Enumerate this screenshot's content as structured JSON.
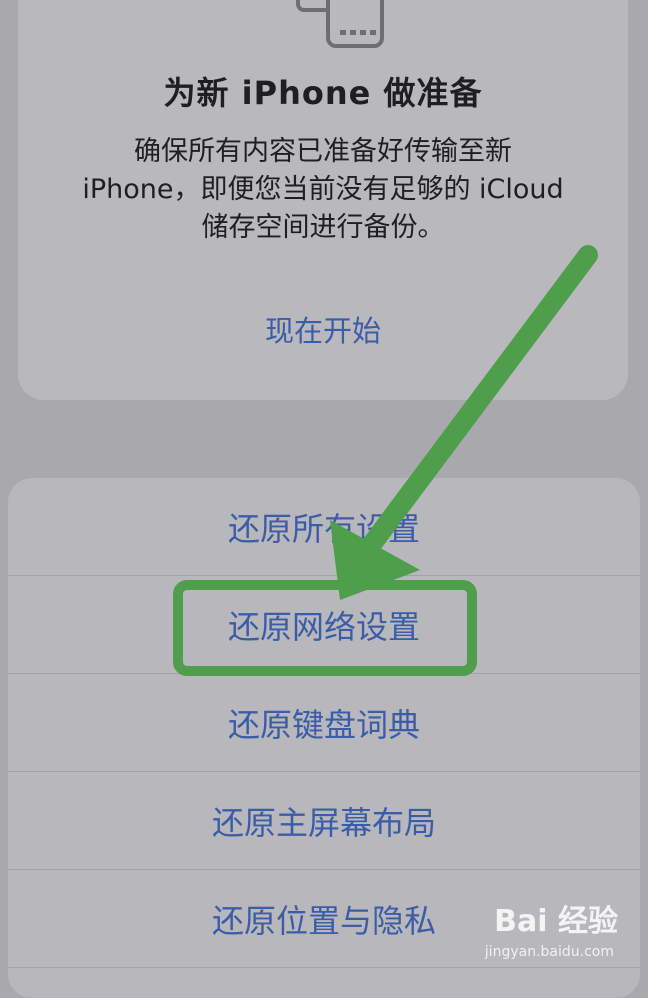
{
  "card": {
    "title": "为新 iPhone 做准备",
    "description": "确保所有内容已准备好传输至新 iPhone，即便您当前没有足够的 iCloud 储存空间进行备份。",
    "action": "现在开始"
  },
  "sheet": {
    "items": [
      {
        "label": "还原所有设置"
      },
      {
        "label": "还原网络设置"
      },
      {
        "label": "还原键盘词典"
      },
      {
        "label": "还原主屏幕布局"
      },
      {
        "label": "还原位置与隐私"
      }
    ]
  },
  "annotation": {
    "arrow_color": "#4f9e4c",
    "highlight_color": "#4f9e4c"
  },
  "watermark": {
    "text": "Bai 经验",
    "sub": "jingyan.baidu.com"
  },
  "colors": {
    "background": "#a9a8ad",
    "card": "#b9b8bd",
    "link": "#3b5da8"
  }
}
